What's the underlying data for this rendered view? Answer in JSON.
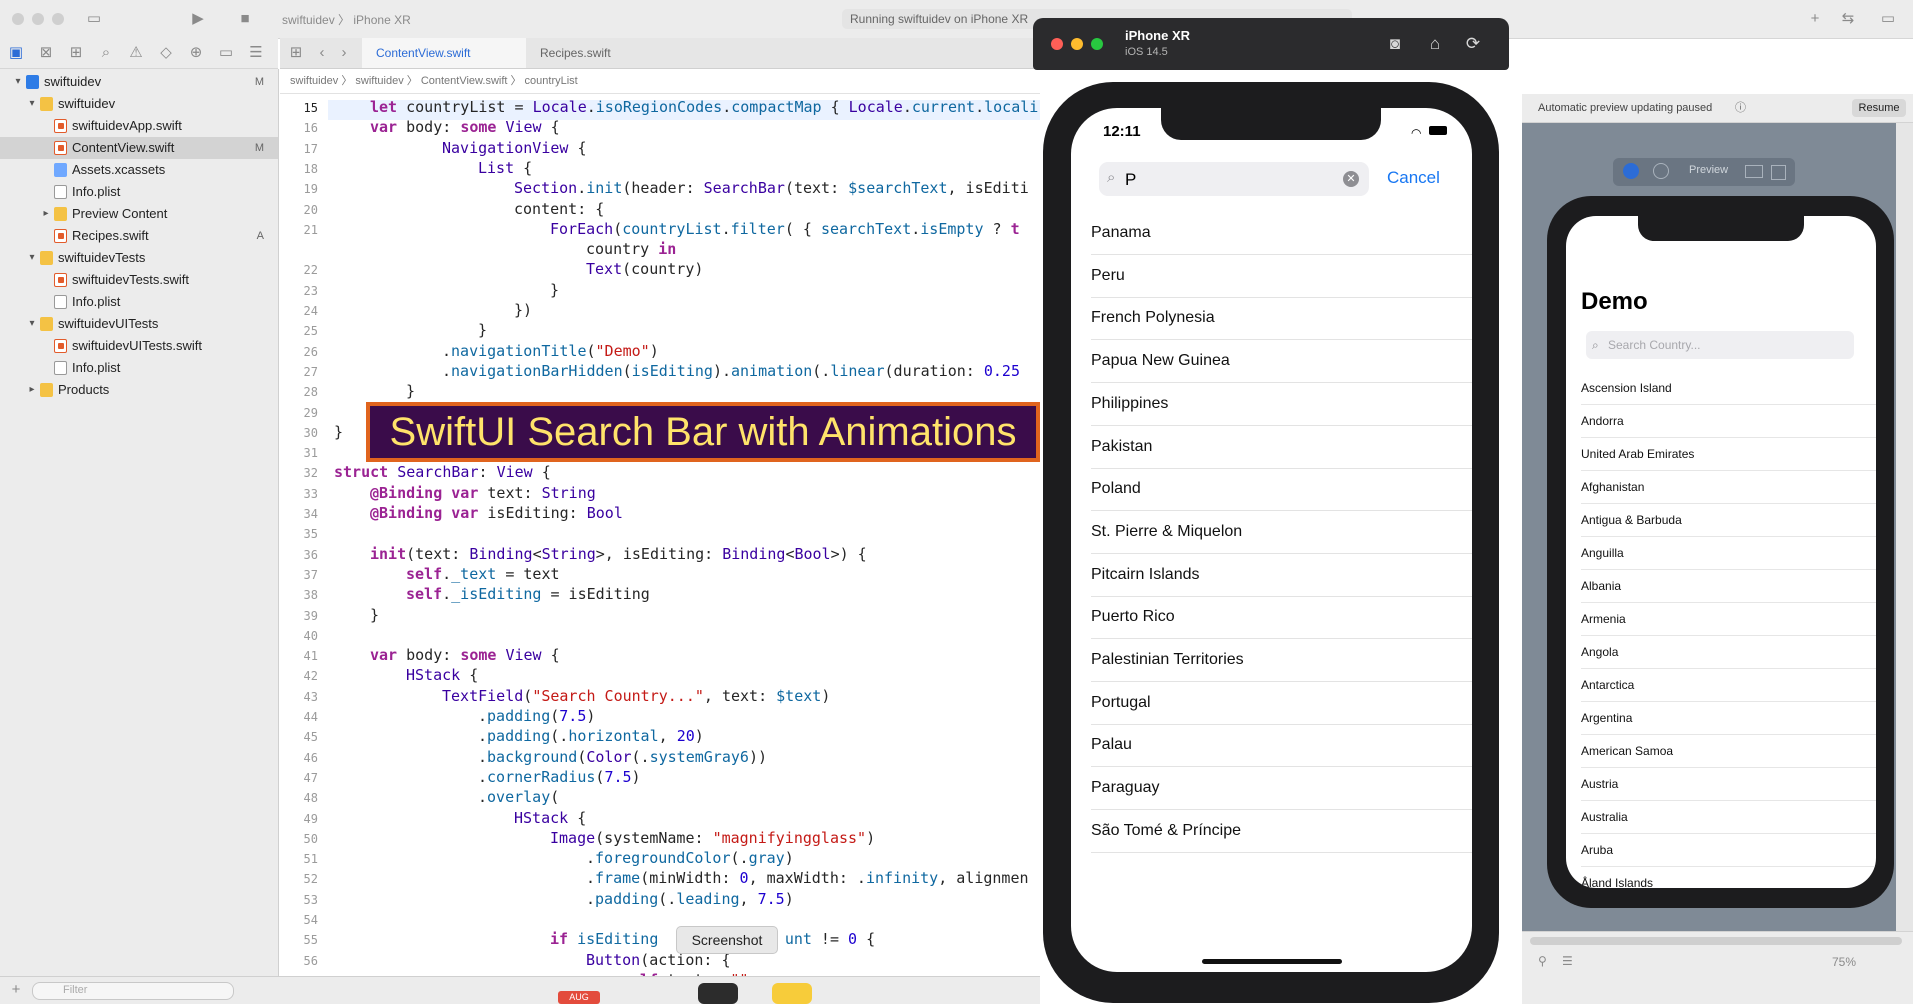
{
  "toolbar": {
    "scheme_project": "swiftuidev",
    "scheme_device": "iPhone XR",
    "activity_status": "Running swiftuidev on iPhone XR"
  },
  "navigator": {
    "items": [
      {
        "label": "swiftuidev",
        "depth": 0,
        "kind": "proj",
        "disclosure": "open",
        "badge": "M"
      },
      {
        "label": "swiftuidev",
        "depth": 1,
        "kind": "fold",
        "disclosure": "open",
        "badge": ""
      },
      {
        "label": "swiftuidevApp.swift",
        "depth": 2,
        "kind": "swift",
        "disclosure": "",
        "badge": ""
      },
      {
        "label": "ContentView.swift",
        "depth": 2,
        "kind": "swift",
        "disclosure": "",
        "badge": "M",
        "selected": true
      },
      {
        "label": "Assets.xcassets",
        "depth": 2,
        "kind": "asset",
        "disclosure": "",
        "badge": ""
      },
      {
        "label": "Info.plist",
        "depth": 2,
        "kind": "plist",
        "disclosure": "",
        "badge": ""
      },
      {
        "label": "Preview Content",
        "depth": 2,
        "kind": "fold",
        "disclosure": "closed",
        "badge": ""
      },
      {
        "label": "Recipes.swift",
        "depth": 2,
        "kind": "swift",
        "disclosure": "",
        "badge": "A"
      },
      {
        "label": "swiftuidevTests",
        "depth": 1,
        "kind": "fold",
        "disclosure": "open",
        "badge": ""
      },
      {
        "label": "swiftuidevTests.swift",
        "depth": 2,
        "kind": "swift",
        "disclosure": "",
        "badge": ""
      },
      {
        "label": "Info.plist",
        "depth": 2,
        "kind": "plist",
        "disclosure": "",
        "badge": ""
      },
      {
        "label": "swiftuidevUITests",
        "depth": 1,
        "kind": "fold",
        "disclosure": "open",
        "badge": ""
      },
      {
        "label": "swiftuidevUITests.swift",
        "depth": 2,
        "kind": "swift",
        "disclosure": "",
        "badge": ""
      },
      {
        "label": "Info.plist",
        "depth": 2,
        "kind": "plist",
        "disclosure": "",
        "badge": ""
      },
      {
        "label": "Products",
        "depth": 1,
        "kind": "fold",
        "disclosure": "closed",
        "badge": ""
      }
    ],
    "filter_placeholder": "Filter"
  },
  "editor": {
    "tabs": [
      {
        "label": "ContentView.swift",
        "active": true
      },
      {
        "label": "Recipes.swift",
        "active": false
      }
    ],
    "breadcrumb": "swiftuidev  〉  swiftuidev  〉  ContentView.swift  〉  countryList",
    "current_line": 15,
    "lines": [
      {
        "n": 15,
        "indent": 1,
        "html": "<span class=\"kw\">let</span> countryList = <span class=\"ty\">Locale</span>.<span class=\"fn\">isoRegionCodes</span>.<span class=\"fn\">compactMap</span> { <span class=\"ty\">Locale</span>.<span class=\"fn\">current</span>.<span class=\"fn\">locali</span>"
      },
      {
        "n": 16,
        "indent": 1,
        "html": "<span class=\"kw\">var</span> body: <span class=\"kw\">some</span> <span class=\"ty\">View</span> {"
      },
      {
        "n": 17,
        "indent": 3,
        "html": "<span class=\"ty\">NavigationView</span> {"
      },
      {
        "n": 18,
        "indent": 4,
        "html": "<span class=\"ty\">List</span> {"
      },
      {
        "n": 19,
        "indent": 5,
        "html": "<span class=\"ty\">Section</span>.<span class=\"fn\">init</span>(header: <span class=\"ty\">SearchBar</span>(text: <span class=\"fn\">$searchText</span>, isEditi"
      },
      {
        "n": 20,
        "indent": 5,
        "html": "content: {"
      },
      {
        "n": 21,
        "indent": 6,
        "html": "<span class=\"ty\">ForEach</span>(<span class=\"fn\">countryList</span>.<span class=\"fn\">filter</span>( { <span class=\"fn\">searchText</span>.<span class=\"fn\">isEmpty</span> ? <span class=\"kw\">t</span>"
      },
      {
        "n": null,
        "indent": 7,
        "html": "country <span class=\"kw\">in</span>"
      },
      {
        "n": 22,
        "indent": 7,
        "html": "<span class=\"ty\">Text</span>(country)"
      },
      {
        "n": 23,
        "indent": 6,
        "html": "}"
      },
      {
        "n": 24,
        "indent": 5,
        "html": "})"
      },
      {
        "n": 25,
        "indent": 4,
        "html": "}"
      },
      {
        "n": 26,
        "indent": 3,
        "html": ".<span class=\"fn\">navigationTitle</span>(<span class=\"st\">\"Demo\"</span>)"
      },
      {
        "n": 27,
        "indent": 3,
        "html": ".<span class=\"fn\">navigationBarHidden</span>(<span class=\"fn\">isEditing</span>).<span class=\"fn\">animation</span>(.<span class=\"fn\">linear</span>(duration: <span class=\"nm\">0.25</span>"
      },
      {
        "n": 28,
        "indent": 2,
        "html": "}"
      },
      {
        "n": 29,
        "indent": 0,
        "html": ""
      },
      {
        "n": 30,
        "indent": 0,
        "html": "}"
      },
      {
        "n": 31,
        "indent": 0,
        "html": ""
      },
      {
        "n": 32,
        "indent": 0,
        "html": "<span class=\"kw\">struct</span> <span class=\"ty\">SearchBar</span>: <span class=\"ty\">View</span> {"
      },
      {
        "n": 33,
        "indent": 1,
        "html": "<span class=\"kw\">@Binding</span> <span class=\"kw\">var</span> text: <span class=\"ty\">String</span>"
      },
      {
        "n": 34,
        "indent": 1,
        "html": "<span class=\"kw\">@Binding</span> <span class=\"kw\">var</span> isEditing: <span class=\"ty\">Bool</span>"
      },
      {
        "n": 35,
        "indent": 0,
        "html": ""
      },
      {
        "n": 36,
        "indent": 1,
        "html": "<span class=\"kw\">init</span>(text: <span class=\"ty\">Binding</span>&lt;<span class=\"ty\">String</span>&gt;, isEditing: <span class=\"ty\">Binding</span>&lt;<span class=\"ty\">Bool</span>&gt;) {"
      },
      {
        "n": 37,
        "indent": 2,
        "html": "<span class=\"kw\">self</span>.<span class=\"fn\">_text</span> = text"
      },
      {
        "n": 38,
        "indent": 2,
        "html": "<span class=\"kw\">self</span>.<span class=\"fn\">_isEditing</span> = isEditing"
      },
      {
        "n": 39,
        "indent": 1,
        "html": "}"
      },
      {
        "n": 40,
        "indent": 0,
        "html": ""
      },
      {
        "n": 41,
        "indent": 1,
        "html": "<span class=\"kw\">var</span> body: <span class=\"kw\">some</span> <span class=\"ty\">View</span> {"
      },
      {
        "n": 42,
        "indent": 2,
        "html": "<span class=\"ty\">HStack</span> {"
      },
      {
        "n": 43,
        "indent": 3,
        "html": "<span class=\"ty\">TextField</span>(<span class=\"st\">\"Search Country...\"</span>, text: <span class=\"fn\">$text</span>)"
      },
      {
        "n": 44,
        "indent": 4,
        "html": ".<span class=\"fn\">padding</span>(<span class=\"nm\">7.5</span>)"
      },
      {
        "n": 45,
        "indent": 4,
        "html": ".<span class=\"fn\">padding</span>(.<span class=\"fn\">horizontal</span>, <span class=\"nm\">20</span>)"
      },
      {
        "n": 46,
        "indent": 4,
        "html": ".<span class=\"fn\">background</span>(<span class=\"ty\">Color</span>(.<span class=\"fn\">systemGray6</span>))"
      },
      {
        "n": 47,
        "indent": 4,
        "html": ".<span class=\"fn\">cornerRadius</span>(<span class=\"nm\">7.5</span>)"
      },
      {
        "n": 48,
        "indent": 4,
        "html": ".<span class=\"fn\">overlay</span>("
      },
      {
        "n": 49,
        "indent": 5,
        "html": "<span class=\"ty\">HStack</span> {"
      },
      {
        "n": 50,
        "indent": 6,
        "html": "<span class=\"ty\">Image</span>(systemName: <span class=\"st\">\"magnifyingglass\"</span>)"
      },
      {
        "n": 51,
        "indent": 7,
        "html": ".<span class=\"fn\">foregroundColor</span>(.<span class=\"fn\">gray</span>)"
      },
      {
        "n": 52,
        "indent": 7,
        "html": ".<span class=\"fn\">frame</span>(minWidth: <span class=\"nm\">0</span>, maxWidth: .<span class=\"fn\">infinity</span>, alignmen"
      },
      {
        "n": 53,
        "indent": 7,
        "html": ".<span class=\"fn\">padding</span>(.<span class=\"fn\">leading</span>, <span class=\"nm\">7.5</span>)"
      },
      {
        "n": 54,
        "indent": 0,
        "html": ""
      },
      {
        "n": 55,
        "indent": 6,
        "html": "<span class=\"kw\">if</span> <span class=\"fn\">isEditing</span>              <span class=\"fn\">unt</span> != <span class=\"nm\">0</span> {"
      },
      {
        "n": 56,
        "indent": 7,
        "html": "<span class=\"ty\">Button</span>(action: {"
      },
      {
        "n": 57,
        "indent": 8,
        "html": "<span class=\"kw\">self</span>.text = <span class=\"st\">\"\"</span>"
      }
    ]
  },
  "banner": {
    "text": "SwiftUI Search Bar with Animations"
  },
  "tooltip": {
    "text": "Screenshot"
  },
  "simulator": {
    "device": "iPhone XR",
    "os": "iOS 14.5",
    "time": "12:11",
    "search_text": "P",
    "cancel_label": "Cancel",
    "results": [
      "Panama",
      "Peru",
      "French Polynesia",
      "Papua New Guinea",
      "Philippines",
      "Pakistan",
      "Poland",
      "St. Pierre & Miquelon",
      "Pitcairn Islands",
      "Puerto Rico",
      "Palestinian Territories",
      "Portugal",
      "Palau",
      "Paraguay",
      "São Tomé & Príncipe"
    ]
  },
  "preview": {
    "status": "Automatic preview updating paused",
    "resume_label": "Resume",
    "toolbar_label": "Preview",
    "title": "Demo",
    "search_placeholder": "Search Country...",
    "countries": [
      "Ascension Island",
      "Andorra",
      "United Arab Emirates",
      "Afghanistan",
      "Antigua & Barbuda",
      "Anguilla",
      "Albania",
      "Armenia",
      "Angola",
      "Antarctica",
      "Argentina",
      "American Samoa",
      "Austria",
      "Australia",
      "Aruba",
      "Åland Islands"
    ],
    "zoom": "75%"
  },
  "dock": {
    "date_badge": "AUG"
  }
}
